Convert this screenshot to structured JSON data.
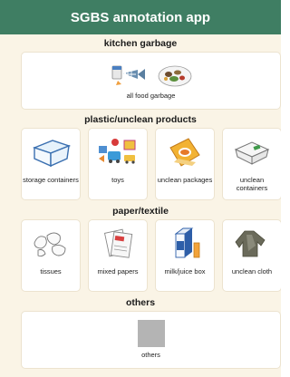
{
  "header": {
    "title": "SGBS annotation app"
  },
  "sections": [
    {
      "title": "kitchen garbage",
      "items": [
        {
          "label": "all food garbage",
          "icon": "food-garbage-icon"
        }
      ]
    },
    {
      "title": "plastic/unclean products",
      "items": [
        {
          "label": "storage containers",
          "icon": "storage-container-icon"
        },
        {
          "label": "toys",
          "icon": "toys-icon"
        },
        {
          "label": "unclean packages",
          "icon": "chip-bag-icon"
        },
        {
          "label": "unclean containers",
          "icon": "takeout-container-icon"
        }
      ]
    },
    {
      "title": "paper/textile",
      "items": [
        {
          "label": "tissues",
          "icon": "tissues-icon"
        },
        {
          "label": "mixed papers",
          "icon": "papers-icon"
        },
        {
          "label": "milk/juice box",
          "icon": "milk-carton-icon"
        },
        {
          "label": "unclean cloth",
          "icon": "cloth-icon"
        }
      ]
    },
    {
      "title": "others",
      "items": [
        {
          "label": "others",
          "icon": "gray-square-icon"
        }
      ]
    }
  ],
  "colors": {
    "header": "#3f7e63",
    "background": "#faf4e6",
    "card": "#ffffff"
  }
}
